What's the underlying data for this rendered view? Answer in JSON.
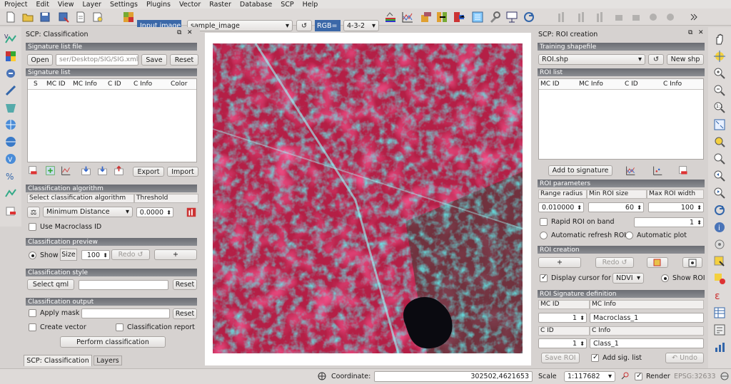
{
  "menu": [
    "Project",
    "Edit",
    "View",
    "Layer",
    "Settings",
    "Plugins",
    "Vector",
    "Raster",
    "Database",
    "SCP",
    "Help"
  ],
  "toolbar": {
    "input_image_label": "Input image",
    "image_select": "sample_image",
    "rgb_label": "RGB=",
    "rgb_select": "4-3-2"
  },
  "left_panel": {
    "title": "SCP: Classification",
    "sig_file_header": "Signature list file",
    "open_btn": "Open",
    "sig_path": "ser/Desktop/SIG/SIG.xml",
    "save_btn": "Save",
    "reset_btn": "Reset",
    "sig_list_header": "Signature list",
    "sig_columns": [
      "S",
      "MC ID",
      "MC Info",
      "C ID",
      "C Info",
      "Color"
    ],
    "export_btn": "Export",
    "import_btn": "Import",
    "algo_header": "Classification algorithm",
    "algo_col1": "Select classification algorithm",
    "algo_col2": "Threshold",
    "algo_select": "Minimum Distance",
    "threshold": "0.0000",
    "macroclass_label": "Use Macroclass ID",
    "preview_header": "Classification preview",
    "show_label": "Show",
    "size_label": "Size",
    "size_value": "100",
    "redo_btn": "Redo",
    "plus_btn": "+",
    "style_header": "Classification style",
    "select_qml_btn": "Select qml",
    "style_reset_btn": "Reset",
    "output_header": "Classification output",
    "apply_mask_label": "Apply mask",
    "mask_reset_btn": "Reset",
    "create_vector_label": "Create vector",
    "class_report_label": "Classification report",
    "perform_btn": "Perform classification",
    "tabs": [
      "SCP: Classification",
      "Layers"
    ]
  },
  "right_panel": {
    "title": "SCP: ROI creation",
    "training_header": "Training shapefile",
    "shapefile_select": "ROI.shp",
    "new_shp_btn": "New shp",
    "roi_list_header": "ROI list",
    "roi_columns": [
      "MC ID",
      "MC Info",
      "C ID",
      "C Info"
    ],
    "add_sig_btn": "Add to signature",
    "params_header": "ROI parameters",
    "range_radius_label": "Range radius",
    "min_roi_label": "Min ROI size",
    "max_roi_label": "Max ROI width",
    "range_radius": "0.010000",
    "min_roi": "60",
    "max_roi": "100",
    "rapid_roi_label": "Rapid ROI on band",
    "rapid_band": "1",
    "auto_refresh_label": "Automatic refresh ROI",
    "auto_plot_label": "Automatic  plot",
    "creation_header": "ROI creation",
    "plus_btn": "+",
    "redo_btn": "Redo",
    "display_cursor_label": "Display cursor for",
    "cursor_select": "NDVI",
    "show_roi_label": "Show ROI",
    "sigdef_header": "ROI Signature definition",
    "mc_id_label": "MC ID",
    "mc_info_label": "MC Info",
    "mc_id_value": "1",
    "mc_info_value": "Macroclass_1",
    "c_id_label": "C ID",
    "c_info_label": "C Info",
    "c_id_value": "1",
    "c_info_value": "Class_1",
    "save_roi_btn": "Save ROI",
    "add_sig_list_label": "Add sig. list",
    "undo_btn": "Undo"
  },
  "status": {
    "coordinate_label": "Coordinate:",
    "coordinate": "302502,4621653",
    "scale_label": "Scale",
    "scale": "1:117682",
    "render_label": "Render",
    "crs": "EPSG:32633"
  }
}
